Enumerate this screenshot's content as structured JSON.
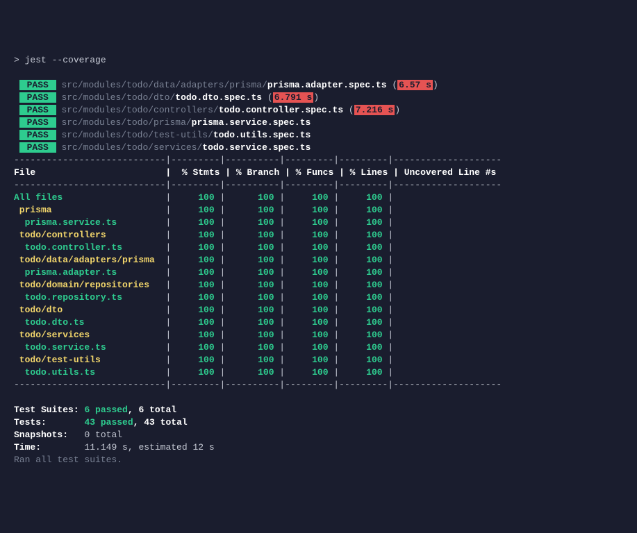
{
  "command": "> jest --coverage",
  "tests": [
    {
      "status": "PASS",
      "path": "src/modules/todo/data/adapters/prisma/",
      "file": "prisma.adapter.spec.ts",
      "time": "6.57 s"
    },
    {
      "status": "PASS",
      "path": "src/modules/todo/dto/",
      "file": "todo.dto.spec.ts",
      "time": "6.791 s"
    },
    {
      "status": "PASS",
      "path": "src/modules/todo/controllers/",
      "file": "todo.controller.spec.ts",
      "time": "7.216 s"
    },
    {
      "status": "PASS",
      "path": "src/modules/todo/prisma/",
      "file": "prisma.service.spec.ts",
      "time": null
    },
    {
      "status": "PASS",
      "path": "src/modules/todo/test-utils/",
      "file": "todo.utils.spec.ts",
      "time": null
    },
    {
      "status": "PASS",
      "path": "src/modules/todo/services/",
      "file": "todo.service.spec.ts",
      "time": null
    }
  ],
  "table": {
    "headers": [
      "File",
      "% Stmts",
      "% Branch",
      "% Funcs",
      "% Lines",
      "Uncovered Line #s"
    ],
    "rows": [
      {
        "name": "All files",
        "color": "teal",
        "indent": 0,
        "stmts": "100",
        "branch": "100",
        "funcs": "100",
        "lines": "100"
      },
      {
        "name": "prisma",
        "color": "yellow",
        "indent": 1,
        "stmts": "100",
        "branch": "100",
        "funcs": "100",
        "lines": "100"
      },
      {
        "name": "prisma.service.ts",
        "color": "teal",
        "indent": 2,
        "stmts": "100",
        "branch": "100",
        "funcs": "100",
        "lines": "100"
      },
      {
        "name": "todo/controllers",
        "color": "yellow",
        "indent": 1,
        "stmts": "100",
        "branch": "100",
        "funcs": "100",
        "lines": "100"
      },
      {
        "name": "todo.controller.ts",
        "color": "teal",
        "indent": 2,
        "stmts": "100",
        "branch": "100",
        "funcs": "100",
        "lines": "100"
      },
      {
        "name": "todo/data/adapters/prisma",
        "color": "yellow",
        "indent": 1,
        "stmts": "100",
        "branch": "100",
        "funcs": "100",
        "lines": "100"
      },
      {
        "name": "prisma.adapter.ts",
        "color": "teal",
        "indent": 2,
        "stmts": "100",
        "branch": "100",
        "funcs": "100",
        "lines": "100"
      },
      {
        "name": "todo/domain/repositories",
        "color": "yellow",
        "indent": 1,
        "stmts": "100",
        "branch": "100",
        "funcs": "100",
        "lines": "100"
      },
      {
        "name": "todo.repository.ts",
        "color": "teal",
        "indent": 2,
        "stmts": "100",
        "branch": "100",
        "funcs": "100",
        "lines": "100"
      },
      {
        "name": "todo/dto",
        "color": "yellow",
        "indent": 1,
        "stmts": "100",
        "branch": "100",
        "funcs": "100",
        "lines": "100"
      },
      {
        "name": "todo.dto.ts",
        "color": "teal",
        "indent": 2,
        "stmts": "100",
        "branch": "100",
        "funcs": "100",
        "lines": "100"
      },
      {
        "name": "todo/services",
        "color": "yellow",
        "indent": 1,
        "stmts": "100",
        "branch": "100",
        "funcs": "100",
        "lines": "100"
      },
      {
        "name": "todo.service.ts",
        "color": "teal",
        "indent": 2,
        "stmts": "100",
        "branch": "100",
        "funcs": "100",
        "lines": "100"
      },
      {
        "name": "todo/test-utils",
        "color": "yellow",
        "indent": 1,
        "stmts": "100",
        "branch": "100",
        "funcs": "100",
        "lines": "100"
      },
      {
        "name": "todo.utils.ts",
        "color": "teal",
        "indent": 2,
        "stmts": "100",
        "branch": "100",
        "funcs": "100",
        "lines": "100"
      }
    ]
  },
  "summary": {
    "suites": {
      "label": "Test Suites:",
      "passed": "6 passed",
      "total": ", 6 total"
    },
    "tests": {
      "label": "Tests:",
      "passed": "43 passed",
      "total": ", 43 total"
    },
    "snapshots": {
      "label": "Snapshots:",
      "value": "0 total"
    },
    "time": {
      "label": "Time:",
      "value": "11.149 s, estimated 12 s"
    },
    "ran": "Ran all test suites."
  }
}
